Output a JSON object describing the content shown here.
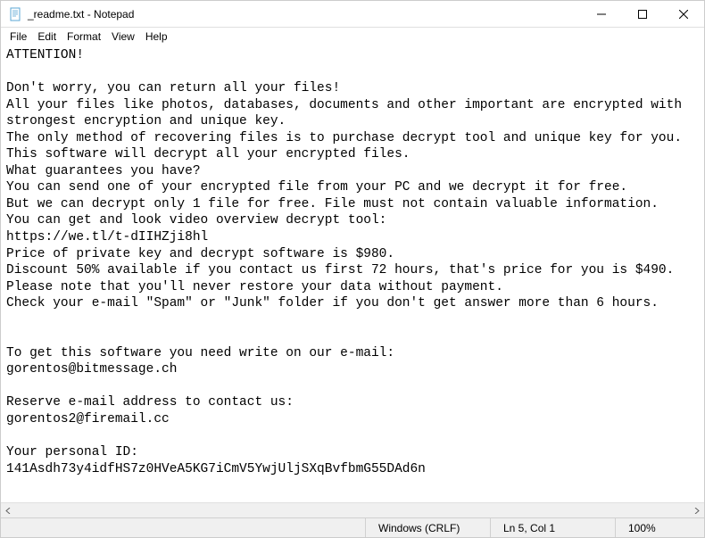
{
  "window": {
    "title": "_readme.txt - Notepad"
  },
  "menubar": {
    "file": "File",
    "edit": "Edit",
    "format": "Format",
    "view": "View",
    "help": "Help"
  },
  "content": {
    "text": "ATTENTION!\n\nDon't worry, you can return all your files!\nAll your files like photos, databases, documents and other important are encrypted with strongest encryption and unique key.\nThe only method of recovering files is to purchase decrypt tool and unique key for you.\nThis software will decrypt all your encrypted files.\nWhat guarantees you have?\nYou can send one of your encrypted file from your PC and we decrypt it for free.\nBut we can decrypt only 1 file for free. File must not contain valuable information.\nYou can get and look video overview decrypt tool:\nhttps://we.tl/t-dIIHZji8hl\nPrice of private key and decrypt software is $980.\nDiscount 50% available if you contact us first 72 hours, that's price for you is $490.\nPlease note that you'll never restore your data without payment.\nCheck your e-mail \"Spam\" or \"Junk\" folder if you don't get answer more than 6 hours.\n\n\nTo get this software you need write on our e-mail:\ngorentos@bitmessage.ch\n\nReserve e-mail address to contact us:\ngorentos2@firemail.cc\n\nYour personal ID:\n141Asdh73y4idfHS7z0HVeA5KG7iCmV5YwjUljSXqBvfbmG55DAd6n"
  },
  "statusbar": {
    "encoding": "Windows (CRLF)",
    "position": "Ln 5, Col 1",
    "zoom": "100%"
  }
}
